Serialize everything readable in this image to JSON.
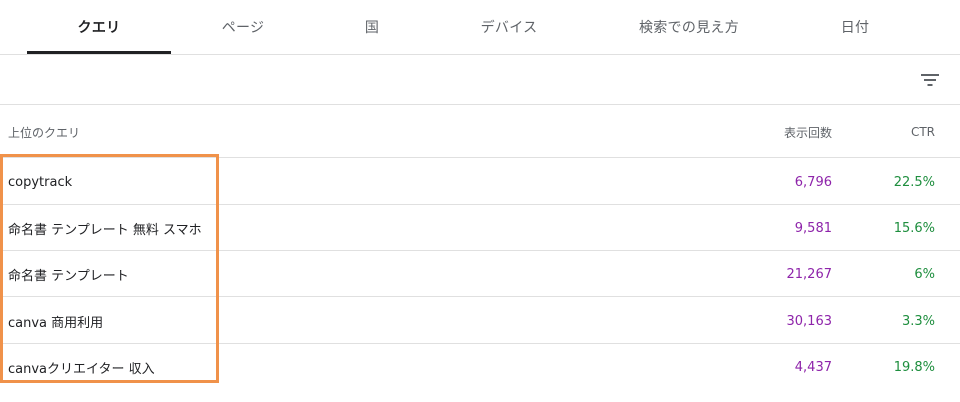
{
  "tabs": [
    {
      "label": "クエリ",
      "active": true
    },
    {
      "label": "ページ",
      "active": false
    },
    {
      "label": "国",
      "active": false
    },
    {
      "label": "デバイス",
      "active": false
    },
    {
      "label": "検索での見え方",
      "active": false
    },
    {
      "label": "日付",
      "active": false
    }
  ],
  "filter": {
    "icon": "filter-icon"
  },
  "table": {
    "headers": {
      "query": "上位のクエリ",
      "impressions": "表示回数",
      "ctr": "CTR"
    },
    "rows": [
      {
        "query": "copytrack",
        "impressions": "6,796",
        "ctr": "22.5%"
      },
      {
        "query": "命名書 テンプレート 無料 スマホ",
        "impressions": "9,581",
        "ctr": "15.6%"
      },
      {
        "query": "命名書 テンプレート",
        "impressions": "21,267",
        "ctr": "6%"
      },
      {
        "query": "canva 商用利用",
        "impressions": "30,163",
        "ctr": "3.3%"
      },
      {
        "query": "canvaクリエイター 収入",
        "impressions": "4,437",
        "ctr": "19.8%"
      }
    ]
  },
  "colors": {
    "impressions": "#8e24aa",
    "ctr": "#1e8e3e",
    "highlight": "#f0924a"
  }
}
